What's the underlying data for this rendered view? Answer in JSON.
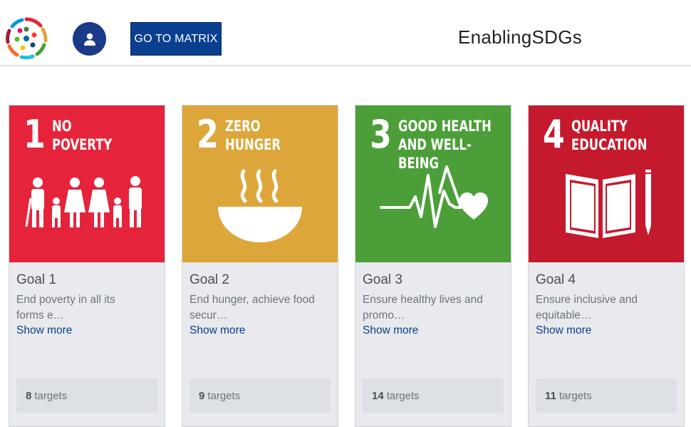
{
  "header": {
    "matrix_button": "GO TO MATRIX",
    "site_title": "EnablingSDGs",
    "avatar_icon": "user-icon",
    "logo_icon": "sdg-wheel-logo"
  },
  "goals": [
    {
      "number": "1",
      "label_line1": "NO",
      "label_line2": "POVERTY",
      "color": "#e5243b",
      "pictogram": "family-icon",
      "title": "Goal 1",
      "desc_line1": "End poverty in all its",
      "desc_line2": "forms e…",
      "show_more": "Show more",
      "targets_count": "8",
      "targets_word": "targets"
    },
    {
      "number": "2",
      "label_line1": "ZERO",
      "label_line2": "HUNGER",
      "color": "#dda63a",
      "pictogram": "bowl-icon",
      "title": "Goal 2",
      "desc_line1": "End hunger, achieve food",
      "desc_line2": "secur…",
      "show_more": "Show more",
      "targets_count": "9",
      "targets_word": "targets"
    },
    {
      "number": "3",
      "label_line1": "GOOD HEALTH",
      "label_line2": "AND WELL-BEING",
      "color": "#4c9f38",
      "pictogram": "heartbeat-icon",
      "title": "Goal 3",
      "desc_line1": "Ensure healthy lives and",
      "desc_line2": "promo…",
      "show_more": "Show more",
      "targets_count": "14",
      "targets_word": "targets"
    },
    {
      "number": "4",
      "label_line1": "QUALITY",
      "label_line2": "EDUCATION",
      "color": "#c5192d",
      "pictogram": "book-pencil-icon",
      "title": "Goal 4",
      "desc_line1": "Ensure inclusive and",
      "desc_line2": "equitable…",
      "show_more": "Show more",
      "targets_count": "11",
      "targets_word": "targets"
    }
  ]
}
